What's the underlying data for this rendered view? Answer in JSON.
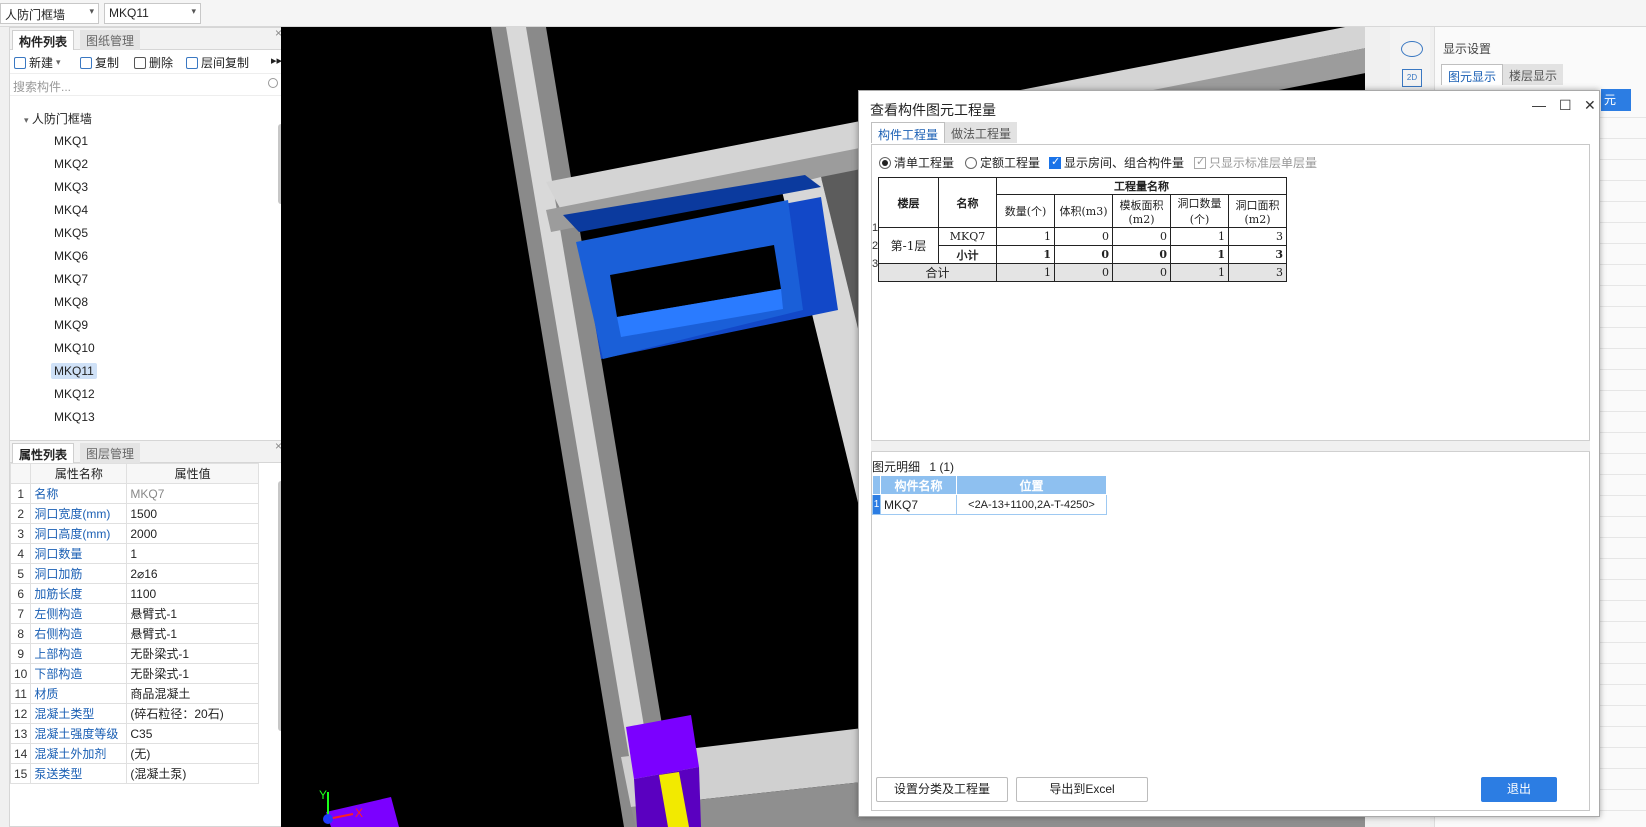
{
  "topbar": {
    "type_select": "人防门框墙",
    "name_select": "MKQ11"
  },
  "component_panel": {
    "tabs": [
      "构件列表",
      "图纸管理"
    ],
    "toolbar": {
      "new": "新建",
      "copy": "复制",
      "delete": "删除",
      "floor_copy": "层间复制"
    },
    "search_placeholder": "搜索构件...",
    "tree_root": "人防门框墙",
    "items": [
      "MKQ1",
      "MKQ2",
      "MKQ3",
      "MKQ4",
      "MKQ5",
      "MKQ6",
      "MKQ7",
      "MKQ8",
      "MKQ9",
      "MKQ10",
      "MKQ11",
      "MKQ12",
      "MKQ13"
    ],
    "selected": "MKQ11"
  },
  "property_panel": {
    "tabs": [
      "属性列表",
      "图层管理"
    ],
    "headers": [
      "属性名称",
      "属性值"
    ],
    "rows": [
      {
        "idx": "1",
        "name": "名称",
        "value": "MKQ7"
      },
      {
        "idx": "2",
        "name": "洞口宽度(mm)",
        "value": "1500"
      },
      {
        "idx": "3",
        "name": "洞口高度(mm)",
        "value": "2000"
      },
      {
        "idx": "4",
        "name": "洞口数量",
        "value": "1"
      },
      {
        "idx": "5",
        "name": "洞口加筋",
        "value": "2⌀16"
      },
      {
        "idx": "6",
        "name": "加筋长度",
        "value": "1100"
      },
      {
        "idx": "7",
        "name": "左侧构造",
        "value": "悬臂式-1"
      },
      {
        "idx": "8",
        "name": "右侧构造",
        "value": "悬臂式-1"
      },
      {
        "idx": "9",
        "name": "上部构造",
        "value": "无卧梁式-1"
      },
      {
        "idx": "10",
        "name": "下部构造",
        "value": "无卧梁式-1"
      },
      {
        "idx": "11",
        "name": "材质",
        "value": "商品混凝土"
      },
      {
        "idx": "12",
        "name": "混凝土类型",
        "value": "(碎石粒径：20石)"
      },
      {
        "idx": "13",
        "name": "混凝土强度等级",
        "value": "C35"
      },
      {
        "idx": "14",
        "name": "混凝土外加剂",
        "value": "(无)"
      },
      {
        "idx": "15",
        "name": "泵送类型",
        "value": "(混凝土泵)"
      }
    ]
  },
  "right_panel": {
    "title": "显示设置",
    "tabs": [
      "图元显示",
      "楼层显示"
    ],
    "clip_text": "元",
    "toggle_2d": "2D"
  },
  "dialog": {
    "title": "查看构件图元工程量",
    "tabs": [
      "构件工程量",
      "做法工程量"
    ],
    "options": {
      "list_qty": "清单工程量",
      "quota_qty": "定额工程量",
      "show_room": "显示房间、组合构件量",
      "std_floor_only": "只显示标准层单层量"
    },
    "table": {
      "col_floor": "楼层",
      "col_name": "名称",
      "group_header": "工程量名称",
      "columns": [
        "数量(个)",
        "体积(m3)",
        "模板面积(m2)",
        "洞口数量(个)",
        "洞口面积(m2)"
      ],
      "floor": "第-1层",
      "rows": [
        {
          "num": "1",
          "name": "MKQ7",
          "values": [
            "1",
            "0",
            "0",
            "1",
            "3"
          ]
        },
        {
          "num": "2",
          "name": "小计",
          "values": [
            "1",
            "0",
            "0",
            "1",
            "3"
          ]
        },
        {
          "num": "3",
          "name": "合计",
          "values": [
            "1",
            "0",
            "0",
            "1",
            "3"
          ]
        }
      ]
    },
    "detail": {
      "label": "图元明细",
      "count": "1 (1)",
      "headers": [
        "构件名称",
        "位置"
      ],
      "rows": [
        {
          "num": "1",
          "name": "MKQ7",
          "position": "<2A-13+1100,2A-T-4250>"
        }
      ]
    },
    "buttons": {
      "set_category": "设置分类及工程量",
      "export_excel": "导出到Excel",
      "exit": "退出"
    }
  },
  "viewport": {
    "axis_x": "X",
    "axis_y": "Y",
    "colors": {
      "wall": "#cfcfcf",
      "door_frame": "#1a5fd8",
      "column": "#7b00ff",
      "rebar": "#f2ea00"
    }
  }
}
